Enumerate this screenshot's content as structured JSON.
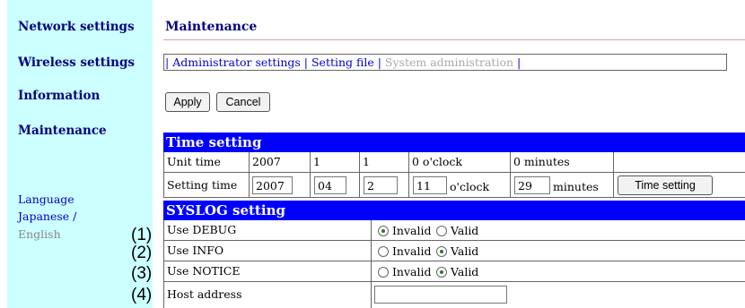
{
  "sidebar": {
    "items": [
      "Network settings",
      "Wireless settings",
      "Information",
      "Maintenance"
    ],
    "language_label": "Language",
    "lang_japanese": "Japanese",
    "lang_sep": " /",
    "lang_english": "English"
  },
  "callouts": [
    "(1)",
    "(2)",
    "(3)",
    "(4)"
  ],
  "page": {
    "title": "Maintenance",
    "tabs_prefix": "| ",
    "tab_admin": "Administrator settings",
    "tab_sep": " | ",
    "tab_file": "Setting file",
    "tab_system": "System administration",
    "tabs_suffix": " |"
  },
  "buttons": {
    "apply": "Apply",
    "cancel": "Cancel",
    "time_setting": "Time setting"
  },
  "time_setting": {
    "header": "Time setting",
    "unit_label": "Unit time",
    "unit_values": [
      "2007",
      "1",
      "1",
      "0 o'clock",
      "0 minutes"
    ],
    "setting_label": "Setting time",
    "year": "2007",
    "month": "04",
    "day": "2",
    "hour": "11",
    "oclock": "o'clock",
    "minute": "29",
    "minutes": "minutes"
  },
  "syslog": {
    "header": "SYSLOG setting",
    "invalid": "Invalid",
    "valid": "Valid",
    "rows": [
      {
        "label": "Use DEBUG",
        "value": "Invalid"
      },
      {
        "label": "Use INFO",
        "value": "Valid"
      },
      {
        "label": "Use NOTICE",
        "value": "Valid"
      }
    ],
    "host_label": "Host address",
    "host_value": ""
  }
}
